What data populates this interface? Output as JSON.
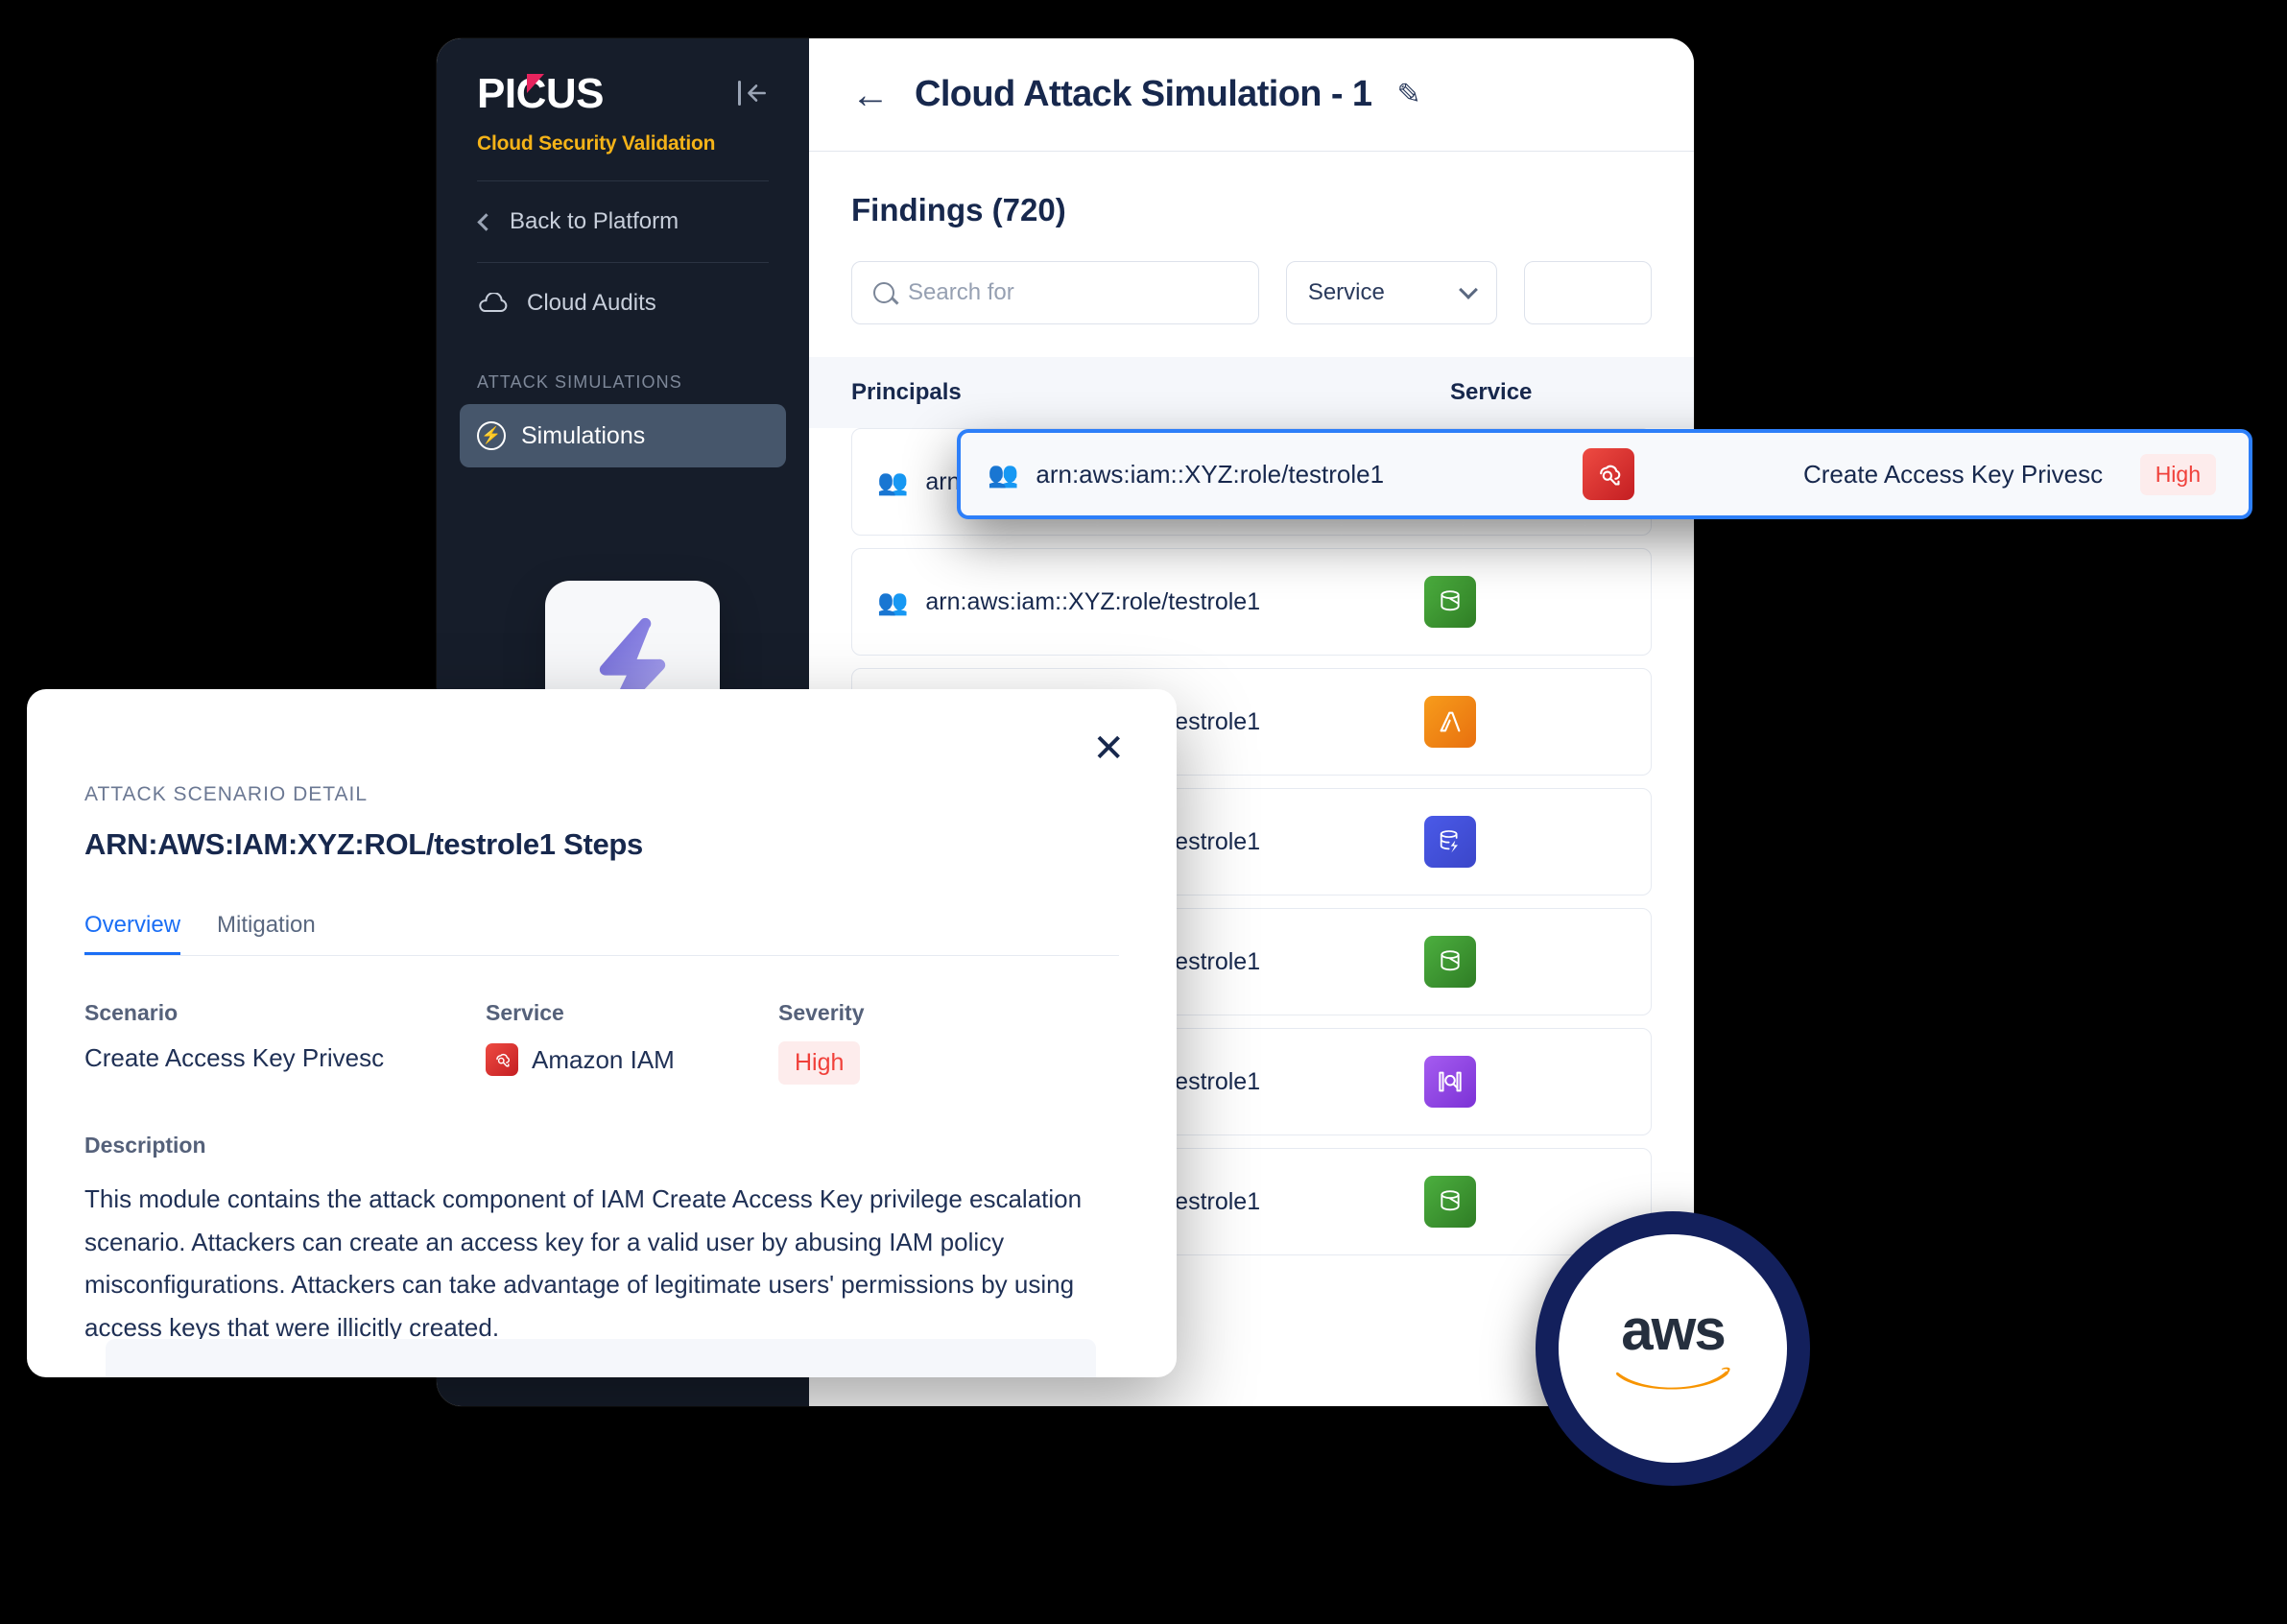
{
  "sidebar": {
    "logo_text": "PICUS",
    "tagline": "Cloud Security Validation",
    "collapse_icon": "collapse-panel-icon",
    "back_label": "Back to Platform",
    "cloud_audits_label": "Cloud Audits",
    "section_label": "ATTACK SIMULATIONS",
    "simulations_label": "Simulations"
  },
  "header": {
    "back_icon": "back-arrow-icon",
    "title": "Cloud  Attack Simulation - 1",
    "edit_icon": "pencil-edit-icon"
  },
  "findings": {
    "heading": "Findings (720)",
    "search_placeholder": "Search for",
    "search_value": "",
    "service_filter_value": "Service",
    "columns": {
      "principals": "Principals",
      "service": "Service"
    },
    "rows": [
      {
        "principal": "arn:aws:iam::XYZ:role/testrole1",
        "service_icon": "s3-bucket-icon",
        "service_class": "svc-s3"
      },
      {
        "principal": "arn:aws:iam::XYZ:role/testrole1",
        "service_icon": "s3-bucket-icon",
        "service_class": "svc-s3"
      },
      {
        "principal": "arn:aws:iam::XYZ:role/testrole1",
        "service_icon": "lambda-icon",
        "service_class": "svc-lambda"
      },
      {
        "principal": "arn:aws:iam::XYZ:role/testrole1",
        "service_icon": "dynamodb-icon",
        "service_class": "svc-ddb"
      },
      {
        "principal": "arn:aws:iam::XYZ:role/testrole1",
        "service_icon": "s3-bucket-icon",
        "service_class": "svc-s3"
      },
      {
        "principal": "arn:aws:iam::XYZ:role/testrole1",
        "service_icon": "inspector-icon",
        "service_class": "svc-purple"
      },
      {
        "principal": "arn:aws:iam::XYZ:role/testrole1",
        "service_icon": "s3-bucket-icon",
        "service_class": "svc-s3"
      }
    ]
  },
  "highlighted_row": {
    "principal": "arn:aws:iam::XYZ:role/testrole1",
    "service_icon": "amazon-iam-icon",
    "scenario": "Create Access Key Privesc",
    "severity": "High"
  },
  "modal": {
    "close_icon": "close-icon",
    "eyebrow": "ATTACK SCENARIO DETAIL",
    "title": "ARN:AWS:IAM:XYZ:ROL/testrole1 Steps",
    "tabs": [
      {
        "label": "Overview",
        "active": true
      },
      {
        "label": "Mitigation",
        "active": false
      }
    ],
    "scenario_label": "Scenario",
    "scenario_value": "Create Access Key Privesc",
    "service_label": "Service",
    "service_value": "Amazon IAM",
    "service_icon": "amazon-iam-icon",
    "severity_label": "Severity",
    "severity_value": "High",
    "description_label": "Description",
    "description_text": "This module contains the attack component of IAM Create Access Key privilege escalation scenario. Attackers can create an access key for a valid user by abusing IAM policy misconfigurations. Attackers can take advantage of legitimate users' permissions by using access keys that were illicitly created."
  },
  "bolt_card": {
    "icon": "lightning-bolt-icon"
  },
  "aws_badge": {
    "wordmark": "aws",
    "icon": "amazon-smile-icon"
  },
  "colors": {
    "sidebar_bg": "#161d2a",
    "accent_yellow": "#f5b318",
    "logo_accent": "#e8245e",
    "highlight_border": "#2d7ff9",
    "severity_high_text": "#f0403a",
    "severity_high_bg": "#fdecec",
    "tab_active": "#1a6ef5",
    "aws_navy": "#13205c",
    "aws_orange": "#f79400"
  }
}
